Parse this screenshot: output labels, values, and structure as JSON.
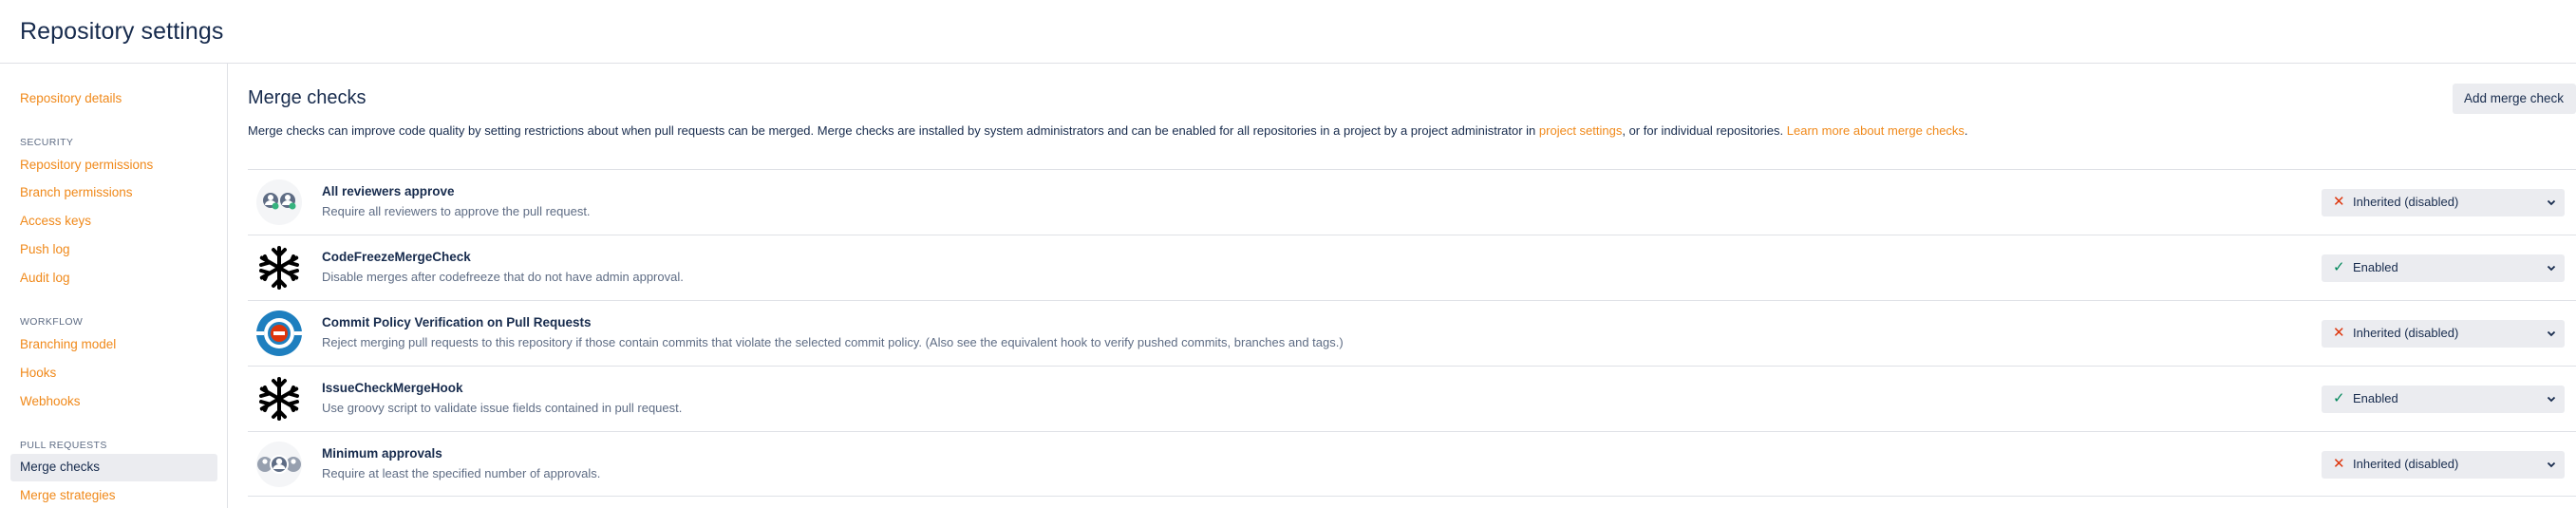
{
  "header": {
    "title": "Repository settings"
  },
  "sidebar": {
    "repository_details": "Repository details",
    "security_heading": "SECURITY",
    "repository_permissions": "Repository permissions",
    "branch_permissions": "Branch permissions",
    "access_keys": "Access keys",
    "push_log": "Push log",
    "audit_log": "Audit log",
    "workflow_heading": "WORKFLOW",
    "branching_model": "Branching model",
    "hooks": "Hooks",
    "webhooks": "Webhooks",
    "pull_requests_heading": "PULL REQUESTS",
    "merge_checks": "Merge checks",
    "merge_strategies": "Merge strategies"
  },
  "main": {
    "title": "Merge checks",
    "add_button": "Add merge check",
    "description": {
      "part1": "Merge checks can improve code quality by setting restrictions about when pull requests can be merged. Merge checks are installed by system administrators and can be enabled for all repositories in a project by a project administrator in ",
      "link1": "project settings",
      "part2": ", or for individual repositories. ",
      "link2": "Learn more about merge checks",
      "part3": "."
    },
    "checks": [
      {
        "name": "All reviewers approve",
        "description": "Require all reviewers to approve the pull request.",
        "status": "Inherited (disabled)",
        "icon": "reviewers-icon"
      },
      {
        "name": "CodeFreezeMergeCheck",
        "description": "Disable merges after codefreeze that do not have admin approval.",
        "status": "Enabled",
        "icon": "snowflake-icon"
      },
      {
        "name": "Commit Policy Verification on Pull Requests",
        "description": "Reject merging pull requests to this repository if those contain commits that violate the selected commit policy. (Also see the equivalent hook to verify pushed commits, branches and tags.)",
        "status": "Inherited (disabled)",
        "icon": "commit-policy-icon"
      },
      {
        "name": "IssueCheckMergeHook",
        "description": "Use groovy script to validate issue fields contained in pull request.",
        "status": "Enabled",
        "icon": "snowflake-icon"
      },
      {
        "name": "Minimum approvals",
        "description": "Require at least the specified number of approvals.",
        "status": "Inherited (disabled)",
        "icon": "approvals-icon"
      }
    ]
  },
  "colors": {
    "link": "#f0891a",
    "text": "#172b4d",
    "muted": "#5e6c84",
    "disabled_x": "#de350b",
    "enabled_check": "#00875a",
    "button_bg": "#ebecf0"
  }
}
